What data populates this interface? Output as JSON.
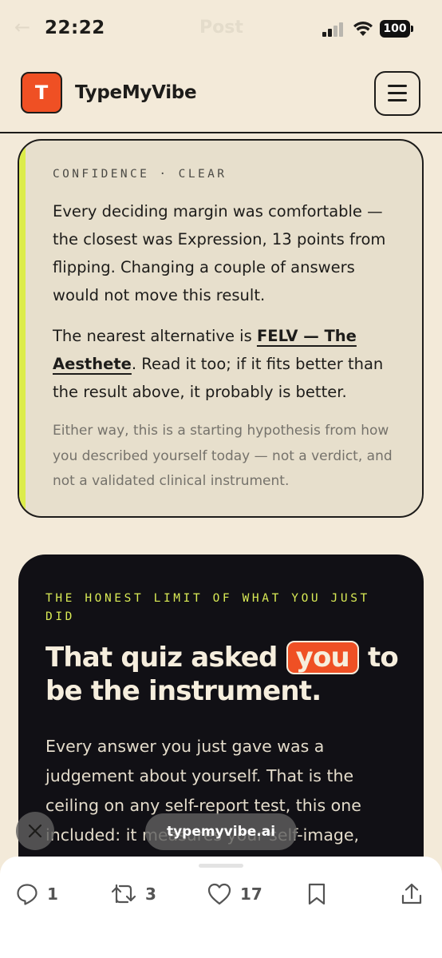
{
  "status_bar": {
    "time": "22:22",
    "battery": "100",
    "ghost_title": "Post"
  },
  "header": {
    "logo_letter": "T",
    "brand": "TypeMyVibe",
    "logo_color": "#ef5024"
  },
  "confidence_card": {
    "kicker": "CONFIDENCE · CLEAR",
    "para1": "Every deciding margin was comfortable — the closest was Expression, 13 points from flipping. Changing a couple of answers would not move this result.",
    "para2_prefix": "The nearest alternative is ",
    "para2_link": "FELV — The Aesthete",
    "para2_suffix": ". Read it too; if it fits better than the result above, it probably is better.",
    "note": "Either way, this is a starting hypothesis from how you described yourself today — not a verdict, and not a validated clinical instrument.",
    "accent_color": "#dcec4a"
  },
  "honest_card": {
    "kicker": "THE HONEST LIMIT OF WHAT YOU JUST DID",
    "headline_pre": "That quiz asked ",
    "headline_highlight": "you",
    "headline_post": " to be the instrument.",
    "body": "Every answer you just gave was a judgement about yourself. That is the ceiling on any self-report test, this one included: it measures your self-image,"
  },
  "overlay": {
    "url": "typemyvibe.ai"
  },
  "actions": {
    "replies": "1",
    "reposts": "3",
    "likes": "17"
  }
}
